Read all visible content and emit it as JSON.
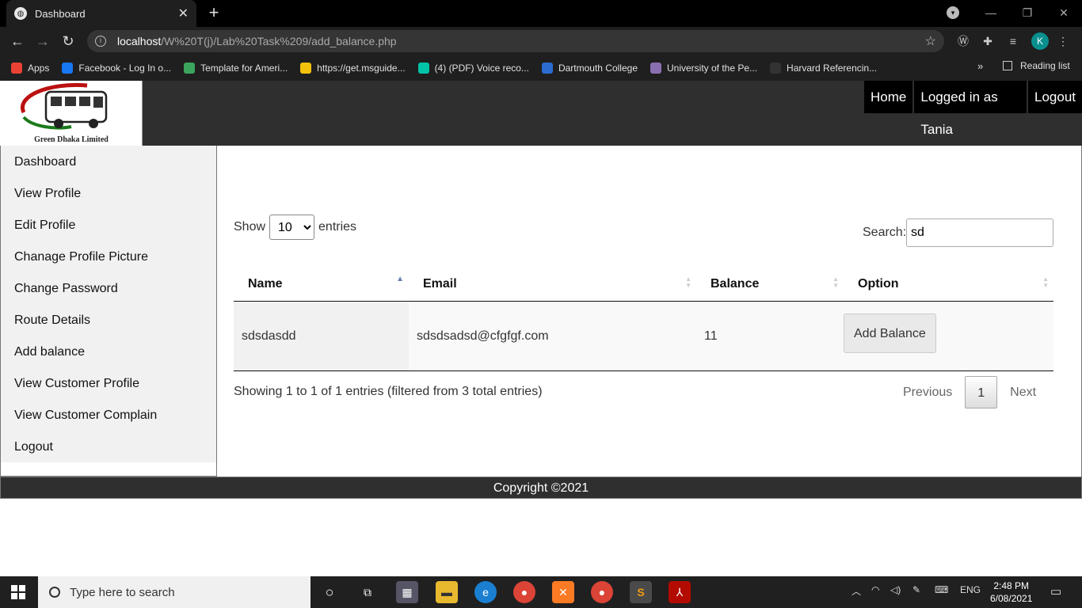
{
  "browser": {
    "tab_title": "Dashboard",
    "tab_close": "✕",
    "new_tab": "+",
    "url_host": "localhost",
    "url_path": "/W%20T(j)/Lab%20Task%209/add_balance.php",
    "profile_initial": "K",
    "bookmarks": [
      {
        "label": "Apps",
        "icon_color": "#e94235"
      },
      {
        "label": "Facebook - Log In o...",
        "icon_color": "#1877f2"
      },
      {
        "label": "Template for Ameri...",
        "icon_color": "#3ba55d"
      },
      {
        "label": "https://get.msguide...",
        "icon_color": "#f4c20d"
      },
      {
        "label": "(4) (PDF) Voice reco...",
        "icon_color": "#00c4a8"
      },
      {
        "label": "Dartmouth College",
        "icon_color": "#2b6cd1"
      },
      {
        "label": "University of the Pe...",
        "icon_color": "#8a6fb0"
      },
      {
        "label": "Harvard Referencin...",
        "icon_color": "#333333"
      }
    ],
    "bookmarks_more": "»",
    "reading_list": "Reading list"
  },
  "header": {
    "logo_text": "Green Dhaka Limited",
    "nav": [
      "Home",
      "Logged in as Tania",
      "Logout"
    ]
  },
  "sidebar": {
    "items": [
      "Dashboard",
      "View Profile",
      "Edit Profile",
      "Chanage Profile Picture",
      "Change Password",
      "Route Details",
      "Add balance",
      "View Customer Profile",
      "View Customer Complain",
      "Logout"
    ]
  },
  "table_controls": {
    "show_label": "Show",
    "entries_label": "entries",
    "length_value": "10",
    "search_label": "Search:",
    "search_value": "sd"
  },
  "table": {
    "columns": [
      "Name",
      "Email",
      "Balance",
      "Option"
    ],
    "rows": [
      {
        "name": "sdsdasdd",
        "email": "sdsdsadsd@cfgfgf.com",
        "balance": "11",
        "option": "Add Balance"
      }
    ]
  },
  "table_info": "Showing 1 to 1 of 1 entries (filtered from 3 total entries)",
  "pagination": {
    "previous": "Previous",
    "current": "1",
    "next": "Next"
  },
  "footer": "Copyright ©2021",
  "taskbar": {
    "search_placeholder": "Type here to search",
    "language": "ENG",
    "time": "2:48 PM",
    "date": "6/08/2021"
  }
}
